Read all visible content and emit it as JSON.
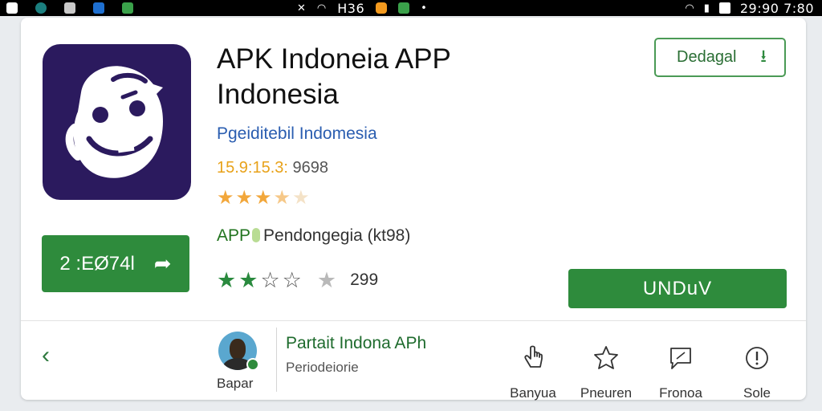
{
  "status_bar": {
    "center_text": "H36",
    "clock": "29:90 7:80",
    "left_icons": [
      "white-square-icon",
      "teal-circle-icon",
      "grey-square-icon",
      "blue-square-icon",
      "green-square-icon"
    ],
    "center_icons": [
      "mute-icon",
      "wifi-icon",
      "orange-app-icon",
      "green-app-icon",
      "dot-icon"
    ],
    "right_icons": [
      "wifi-icon",
      "signal-icon",
      "battery-icon"
    ]
  },
  "app": {
    "title": "APK Indoneia APP Indonesia",
    "developer": "Pgeiditebil Indomesia",
    "rating_highlight": "15.9:15.3:",
    "rating_count": "9698",
    "top_stars": 3.5,
    "category_app": "APP",
    "category_text": "Pendongegia (kt98)",
    "bottom_stars": 2.5,
    "bottom_count": "299"
  },
  "buttons": {
    "left_label": "2 :EØ74l",
    "download_label": "Dedagal",
    "install_label": "UNDuV"
  },
  "publisher": {
    "avatar_label": "Bapar",
    "title": "Partait Indona APh",
    "subtitle": "Periodeiorie"
  },
  "actions": [
    {
      "label": "Banyua",
      "icon": "hand-pointer-icon"
    },
    {
      "label": "Pneuren",
      "icon": "star-outline-icon"
    },
    {
      "label": "Fronoa",
      "icon": "chat-bubble-icon"
    },
    {
      "label": "Sole",
      "icon": "info-icon"
    }
  ],
  "colors": {
    "accent_green": "#2e8b3c",
    "icon_bg": "#2b1a5e",
    "developer_blue": "#2a5db0",
    "star_gold": "#f2a73b"
  }
}
